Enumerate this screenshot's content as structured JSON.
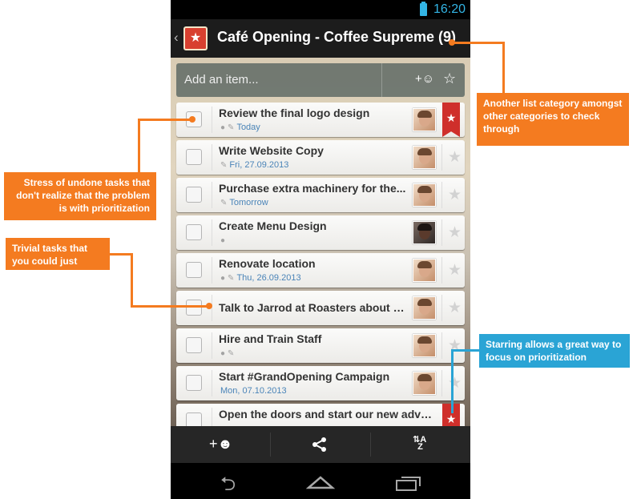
{
  "status_bar": {
    "time": "16:20"
  },
  "header": {
    "back_icon": "‹",
    "title": "Café Opening - Coffee Supreme (9)"
  },
  "add_item": {
    "placeholder": "Add an item...",
    "assign_icon": "person-add-icon",
    "star_icon": "star-icon"
  },
  "tasks": [
    {
      "title": "Review the final logo design",
      "date": "Today",
      "has_comment": true,
      "has_pin": true,
      "starred": true
    },
    {
      "title": "Write Website Copy",
      "date": "Fri, 27.09.2013",
      "has_comment": false,
      "has_pin": true,
      "starred": false
    },
    {
      "title": "Purchase extra machinery for the...",
      "date": "Tomorrow",
      "has_comment": false,
      "has_pin": true,
      "starred": false
    },
    {
      "title": "Create Menu Design",
      "date": "",
      "has_comment": true,
      "has_pin": false,
      "starred": false
    },
    {
      "title": "Renovate location",
      "date": "Thu, 26.09.2013",
      "has_comment": true,
      "has_pin": true,
      "starred": false
    },
    {
      "title": "Talk to Jarrod at Roasters about d...",
      "date": "",
      "has_comment": false,
      "has_pin": false,
      "starred": false
    },
    {
      "title": "Hire and Train Staff",
      "date": "",
      "has_comment": true,
      "has_pin": true,
      "starred": false
    },
    {
      "title": "Start #GrandOpening Campaign",
      "date": "Mon, 07.10.2013",
      "has_comment": false,
      "has_pin": false,
      "starred": false
    },
    {
      "title": "Open the doors and start our new adven...",
      "date": "",
      "has_comment": false,
      "has_pin": false,
      "starred": true
    }
  ],
  "bottom_bar": {
    "buttons": [
      "share-with-person-icon",
      "share-icon",
      "sort-az-icon"
    ]
  },
  "nav_bar": {
    "buttons": [
      "back-icon",
      "home-icon",
      "recent-apps-icon"
    ]
  },
  "callouts": {
    "category": "Another list category amongst other categories to check through",
    "stress": "Stress of undone tasks that don't realize that the problem is with prioritization",
    "trivial": "Trivial tasks that you could just remember",
    "starring": "Starring allows a great way to focus on prioritization"
  },
  "colors": {
    "accent_orange": "#f47b20",
    "accent_blue": "#2aa4d5",
    "status_blue": "#33b5e5",
    "star_red": "#cf2f2b"
  }
}
